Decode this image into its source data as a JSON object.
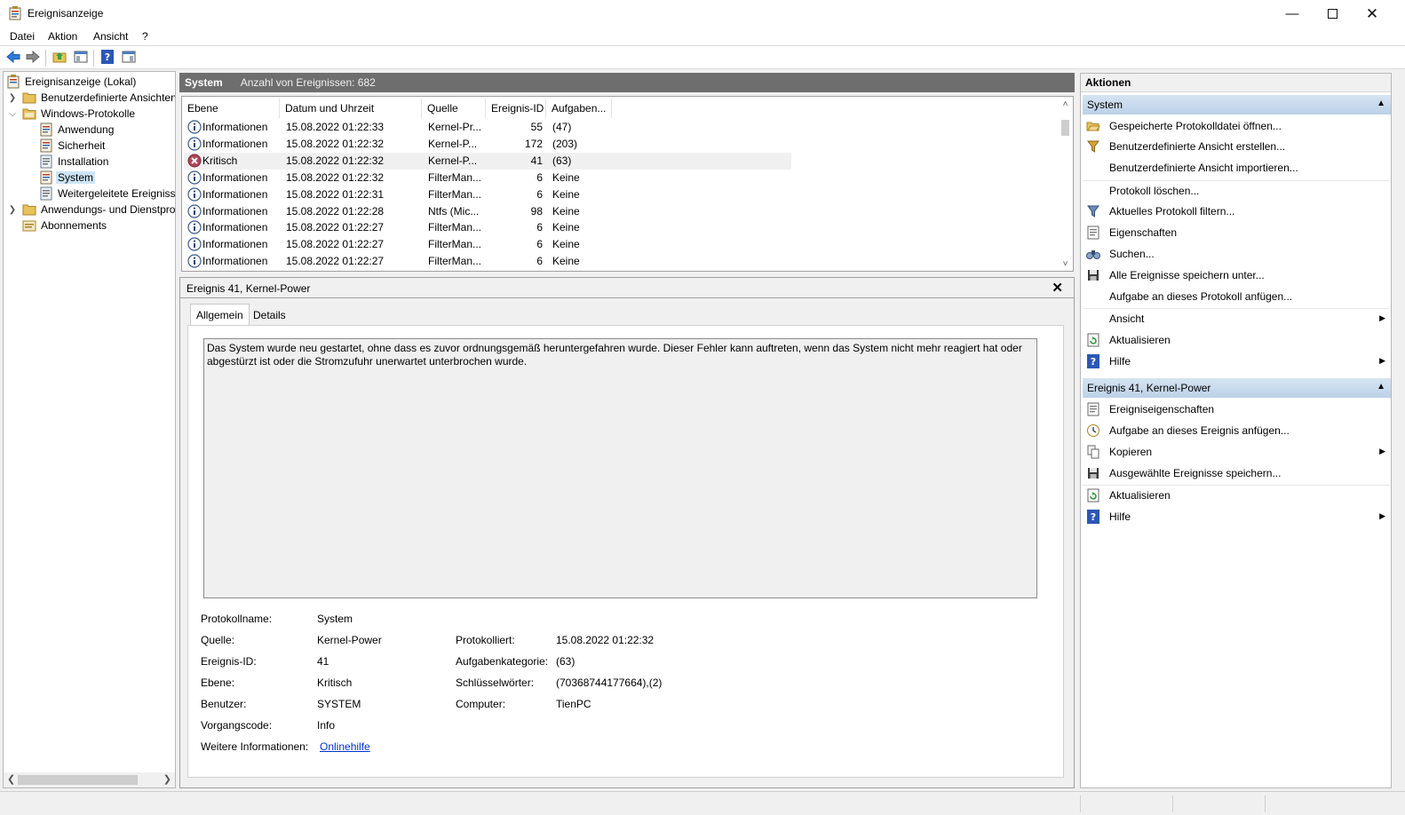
{
  "window": {
    "title": "Ereignisanzeige",
    "minimize_icon": "minimize-icon",
    "maximize_icon": "maximize-icon",
    "close_icon": "close-icon"
  },
  "menu": [
    "Datei",
    "Aktion",
    "Ansicht",
    "?"
  ],
  "tree": {
    "root": "Ereignisanzeige (Lokal)",
    "items": [
      {
        "label": "Benutzerdefinierte Ansichten"
      },
      {
        "label": "Windows-Protokolle"
      },
      {
        "label": "Anwendung"
      },
      {
        "label": "Sicherheit"
      },
      {
        "label": "Installation"
      },
      {
        "label": "System"
      },
      {
        "label": "Weitergeleitete Ereignisse"
      },
      {
        "label": "Anwendungs- und Dienstprotokolle"
      },
      {
        "label": "Abonnements"
      }
    ]
  },
  "log_header": {
    "name": "System",
    "count": "Anzahl von Ereignissen: 682"
  },
  "events": {
    "columns": [
      "Ebene",
      "Datum und Uhrzeit",
      "Quelle",
      "Ereignis-ID",
      "Aufgaben..."
    ],
    "rows": [
      {
        "level": "Informationen",
        "date": "15.08.2022 01:22:33",
        "source": "Kernel-Pr...",
        "id": "55",
        "task": "(47)"
      },
      {
        "level": "Informationen",
        "date": "15.08.2022 01:22:32",
        "source": "Kernel-P...",
        "id": "172",
        "task": "(203)"
      },
      {
        "level": "Kritisch",
        "date": "15.08.2022 01:22:32",
        "source": "Kernel-P...",
        "id": "41",
        "task": "(63)"
      },
      {
        "level": "Informationen",
        "date": "15.08.2022 01:22:32",
        "source": "FilterMan...",
        "id": "6",
        "task": "Keine"
      },
      {
        "level": "Informationen",
        "date": "15.08.2022 01:22:31",
        "source": "FilterMan...",
        "id": "6",
        "task": "Keine"
      },
      {
        "level": "Informationen",
        "date": "15.08.2022 01:22:28",
        "source": "Ntfs (Mic...",
        "id": "98",
        "task": "Keine"
      },
      {
        "level": "Informationen",
        "date": "15.08.2022 01:22:27",
        "source": "FilterMan...",
        "id": "6",
        "task": "Keine"
      },
      {
        "level": "Informationen",
        "date": "15.08.2022 01:22:27",
        "source": "FilterMan...",
        "id": "6",
        "task": "Keine"
      },
      {
        "level": "Informationen",
        "date": "15.08.2022 01:22:27",
        "source": "FilterMan...",
        "id": "6",
        "task": "Keine"
      }
    ]
  },
  "detail": {
    "title": "Ereignis 41, Kernel-Power",
    "tabs": [
      "Allgemein",
      "Details"
    ],
    "description": "Das System wurde neu gestartet, ohne dass es zuvor ordnungsgemäß heruntergefahren wurde. Dieser Fehler kann auftreten, wenn das System nicht mehr reagiert hat oder abgestürzt ist oder die Stromzufuhr unerwartet unterbrochen wurde.",
    "props": {
      "protokollname_label": "Protokollname:",
      "protokollname": "System",
      "quelle_label": "Quelle:",
      "quelle": "Kernel-Power",
      "protokolliert_label": "Protokolliert:",
      "protokolliert": "15.08.2022 01:22:32",
      "ereignisid_label": "Ereignis-ID:",
      "ereignisid": "41",
      "aufgabenkategorie_label": "Aufgabenkategorie:",
      "aufgabenkategorie": "(63)",
      "ebene_label": "Ebene:",
      "ebene": "Kritisch",
      "schluessel_label": "Schlüsselwörter:",
      "schluessel": "(70368744177664),(2)",
      "benutzer_label": "Benutzer:",
      "benutzer": "SYSTEM",
      "computer_label": "Computer:",
      "computer": "TienPC",
      "vorgang_label": "Vorgangscode:",
      "vorgang": "Info",
      "weitere_label": "Weitere Informationen:",
      "weitere_link": "Onlinehilfe"
    }
  },
  "actions": {
    "title": "Aktionen",
    "group1": "System",
    "group1_items": [
      "Gespeicherte Protokolldatei öffnen...",
      "Benutzerdefinierte Ansicht erstellen...",
      "Benutzerdefinierte Ansicht importieren...",
      "Protokoll löschen...",
      "Aktuelles Protokoll filtern...",
      "Eigenschaften",
      "Suchen...",
      "Alle Ereignisse speichern unter...",
      "Aufgabe an dieses Protokoll anfügen...",
      "Ansicht",
      "Aktualisieren",
      "Hilfe"
    ],
    "group2": "Ereignis 41, Kernel-Power",
    "group2_items": [
      "Ereigniseigenschaften",
      "Aufgabe an dieses Ereignis anfügen...",
      "Kopieren",
      "Ausgewählte Ereignisse speichern...",
      "Aktualisieren",
      "Hilfe"
    ]
  }
}
